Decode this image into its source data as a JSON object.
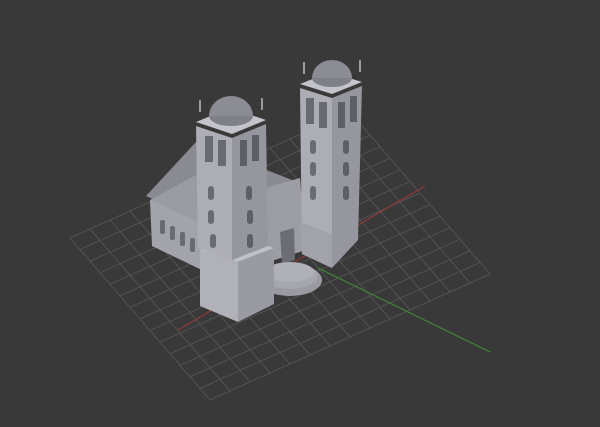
{
  "viewport": {
    "background": "#393939",
    "grid_color": "#4a4a4a",
    "grid_line_color": "#545454",
    "x_axis_color": "#8f3a3a",
    "y_axis_color": "#3f8b33"
  },
  "model": {
    "surface_color": "#a9a9b1",
    "shadow_color": "#86868f",
    "dark_color": "#5f5f68",
    "dome_color": "#8c8c94"
  }
}
